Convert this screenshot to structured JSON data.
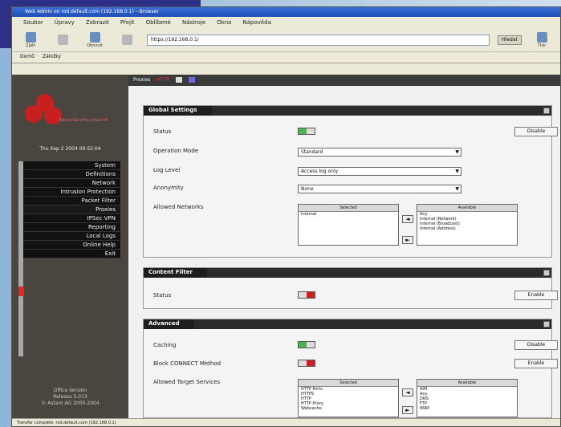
{
  "window": {
    "title": "Web Admin on rod.default.com (192.168.0.1) – Browser"
  },
  "menu": [
    "Soubor",
    "Úpravy",
    "Zobrazit",
    "Přejít",
    "Oblíbené",
    "Nástroje",
    "Okno",
    "Nápověda"
  ],
  "toolbar": {
    "back_label": "Zpět",
    "reload_label": "Obnovit",
    "print_label": "Tisk",
    "address": "https://192.168.0.1/",
    "go_label": "Hledat"
  },
  "links": [
    "Domů",
    "Záložky"
  ],
  "sidebar": {
    "brand": "Astaro Security Linux V6",
    "datetime": "Thu Sep 2 2004 09:52:04",
    "nav": [
      "System",
      "Definitions",
      "Network",
      "Intrusion Protection",
      "Packet Filter",
      "Proxies",
      "IPSec VPN",
      "Reporting",
      "Local Logs",
      "Online Help",
      "Exit"
    ],
    "active_nav": "Proxies",
    "footer": [
      "Office Version",
      "Release 5.013",
      "© Astaro AG 2000-2004"
    ]
  },
  "topbar": {
    "label": "Proxies",
    "status": "HTTP"
  },
  "sections": {
    "global": {
      "title": "Global Settings",
      "status_label": "Status",
      "status_button": "Disable",
      "mode_label": "Operation Mode",
      "mode_value": "Standard",
      "log_label": "Log Level",
      "log_value": "Access log only",
      "anon_label": "Anonymity",
      "anon_value": "None",
      "networks_label": "Allowed Networks",
      "selected_head": "Selected",
      "available_head": "Available",
      "selected": [
        "Internal"
      ],
      "available": [
        "Any",
        "Internal (Network)",
        "Internal (Broadcast)",
        "Internal (Address)"
      ]
    },
    "filter": {
      "title": "Content Filter",
      "status_label": "Status",
      "status_button": "Enable"
    },
    "advanced": {
      "title": "Advanced",
      "caching_label": "Caching",
      "caching_button": "Disable",
      "connect_label": "Block CONNECT Method",
      "connect_button": "Enable",
      "targets_label": "Allowed Target Services",
      "selected_head": "Selected",
      "available_head": "Available",
      "selected": [
        "HTTP Ports",
        "HTTPS",
        "HTTP",
        "HTTP Proxy",
        "Webcache"
      ],
      "available": [
        "AIM",
        "Any",
        "DNS",
        "FTP",
        "IMAP"
      ]
    }
  },
  "statusbar": {
    "text": "Transfer complete: rod.default.com (192.168.0.1)"
  },
  "colors": {
    "on": "#4fb24f",
    "off": "#cc2020",
    "sidebar": "#4a453f",
    "accent": "#e02626"
  }
}
